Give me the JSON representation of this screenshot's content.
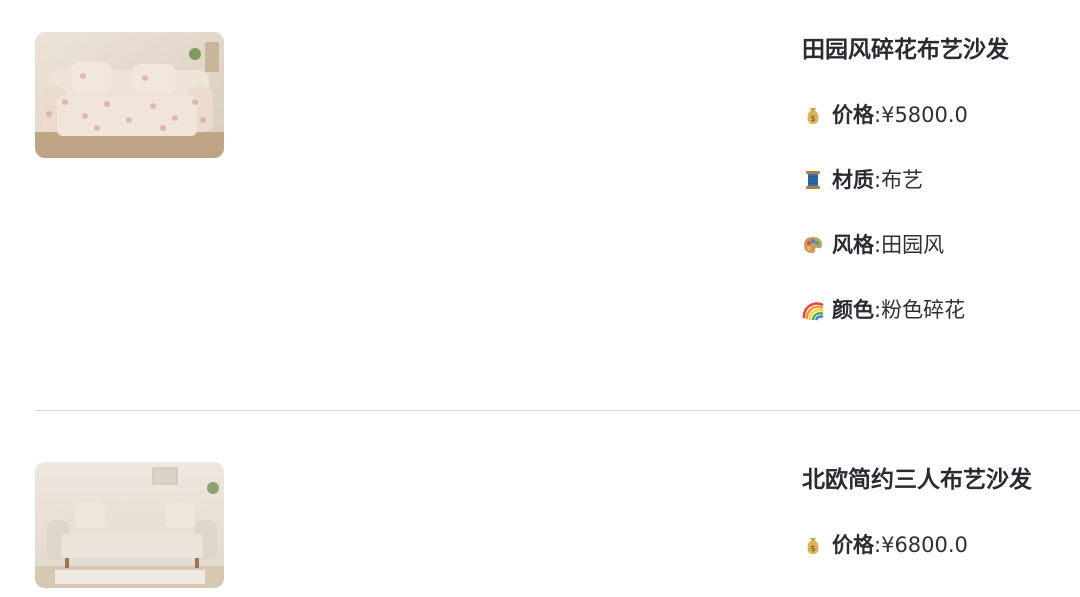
{
  "products": [
    {
      "title": "田园风碎花布艺沙发",
      "image_alt": "floral fabric sofa photo",
      "fields": [
        {
          "icon": "money-bag-icon",
          "key": "价格",
          "sep": ": ",
          "value": "¥5800.0"
        },
        {
          "icon": "thread-spool-icon",
          "key": "材质",
          "sep": ": ",
          "value": "布艺"
        },
        {
          "icon": "palette-icon",
          "key": "风格",
          "sep": ": ",
          "value": "田园风"
        },
        {
          "icon": "rainbow-icon",
          "key": "颜色",
          "sep": ": ",
          "value": "粉色碎花"
        }
      ]
    },
    {
      "title": "北欧简约三人布艺沙发",
      "image_alt": "beige three-seat sofa photo",
      "fields": [
        {
          "icon": "money-bag-icon",
          "key": "价格",
          "sep": ": ",
          "value": "¥6800.0"
        }
      ]
    }
  ],
  "colors": {
    "text": "#2b2b33",
    "divider": "#d9d9dc",
    "floral_sofa": "#efe2d6",
    "beige_sofa": "#e7e0d6"
  }
}
